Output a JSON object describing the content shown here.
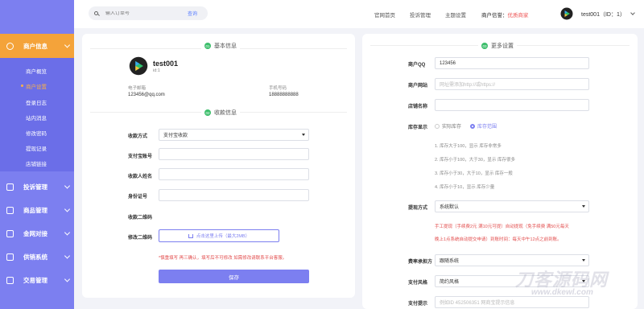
{
  "sidebar": {
    "active_section": "商户信息",
    "sub_items": [
      "商户概览",
      "商户设置",
      "登录日志",
      "站内消息",
      "修改密码",
      "提现记录",
      "店铺链接"
    ],
    "sections": [
      "投诉管理",
      "商品管理",
      "金网对接",
      "供销系统",
      "交易管理"
    ]
  },
  "topbar": {
    "search_placeholder": "输入订单号",
    "search_button": "查询",
    "nav": [
      "官网首页",
      "投诉管理",
      "主题设置"
    ],
    "reputation_label": "商户信誉：",
    "reputation_value": "优质商家",
    "username": "test001（ID：1）"
  },
  "basic": {
    "title_num": "01",
    "title": "基本信息",
    "name": "test001",
    "id": "id:1",
    "email_label": "电子邮箱",
    "email": "123456@qq.com",
    "phone_label": "手机号码",
    "phone": "18888888888"
  },
  "payment": {
    "title_num": "02",
    "title": "收款信息",
    "method_label": "收款方式",
    "method_value": "支付宝收款",
    "account_label": "支付宝账号",
    "name_label": "收款人姓名",
    "idcard_label": "身份证号",
    "qr_label": "收款二维码",
    "modify_qr_label": "修改二维码",
    "upload_text": "点击这里上传（最大2MB）",
    "note": "*慎重填写 再三确认，填写后不可修改 如需修改请联系平台客服。",
    "save": "保存"
  },
  "more": {
    "title_num": "03",
    "title": "更多设置",
    "qq_label": "商户QQ",
    "qq_value": "123456",
    "site_label": "商户网站",
    "site_placeholder": "网址需添加http://或https://",
    "shop_label": "店铺名称",
    "stock_label": "库存显示",
    "stock_opt1": "实际库存",
    "stock_opt2": "库存范围",
    "stock_rules": [
      "1. 库存大于100，显示 库存非常多",
      "2. 库存小于100，大于30，显示 库存很多",
      "3. 库存小于30，大于10，显示 库存一般",
      "4. 库存小于10，显示 库存少量"
    ],
    "withdraw_label": "提现方式",
    "withdraw_value": "系统默认",
    "withdraw_note1": "手工提现（手续费2元 满10元可提）自动提现（免手续费 满50元每天",
    "withdraw_note2": "晚上1点系统自动提交申请）到账时间：每天中午12点之前到账。",
    "fee_label": "费率承担方",
    "fee_value": "跟随系统",
    "style_label": "支付风格",
    "style_value": "简约风格",
    "tip_label": "支付提示",
    "tip_placeholder": "例如ID 452506351 网商宝提示信息"
  },
  "watermark": {
    "line1": "刀客源码网",
    "line2": "www.dkewl.com"
  }
}
